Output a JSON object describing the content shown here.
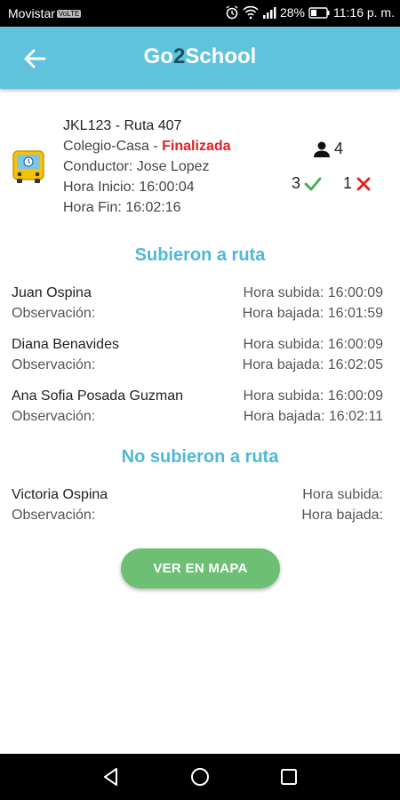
{
  "status_bar": {
    "carrier": "Movistar",
    "carrier_badge": "VoLTE",
    "battery": "28%",
    "time": "11:16 p. m."
  },
  "app_bar": {
    "title_part1": "Go",
    "title_part2": "2",
    "title_part3": "School",
    "title_accent_color": "#1d4f5e",
    "background_color": "#5fc3dc"
  },
  "route": {
    "plate_route": "JKL123 - Ruta 407",
    "direction": "Colegio-Casa - ",
    "status": "Finalizada",
    "driver": "Conductor: Jose Lopez",
    "start_time": "Hora Inicio: 16:00:04",
    "end_time": "Hora Fin: 16:02:16",
    "passenger_count": "4",
    "boarded_count": "3",
    "not_boarded_count": "1",
    "status_color": "#e02020"
  },
  "boarded_section": {
    "title": "Subieron a ruta",
    "riders": [
      {
        "name": "Juan Ospina",
        "observation": "Observación:",
        "up": "Hora subida: 16:00:09",
        "down": "Hora bajada: 16:01:59"
      },
      {
        "name": "Diana Benavides",
        "observation": "Observación:",
        "up": "Hora subida: 16:00:09",
        "down": "Hora bajada: 16:02:05"
      },
      {
        "name": "Ana Sofia Posada Guzman",
        "observation": "Observación:",
        "up": "Hora subida: 16:00:09",
        "down": "Hora bajada: 16:02:11"
      }
    ]
  },
  "not_boarded_section": {
    "title": "No subieron a ruta",
    "riders": [
      {
        "name": "Victoria Ospina",
        "observation": "Observación:",
        "up": "Hora subida:",
        "down": "Hora bajada:"
      }
    ]
  },
  "map_button": {
    "label": "VER EN MAPA",
    "color": "#6dbf73"
  },
  "icons": {
    "back": "arrow-left-icon",
    "bus": "bus-icon",
    "person": "person-icon",
    "check": "check-icon",
    "cross": "cross-icon"
  }
}
